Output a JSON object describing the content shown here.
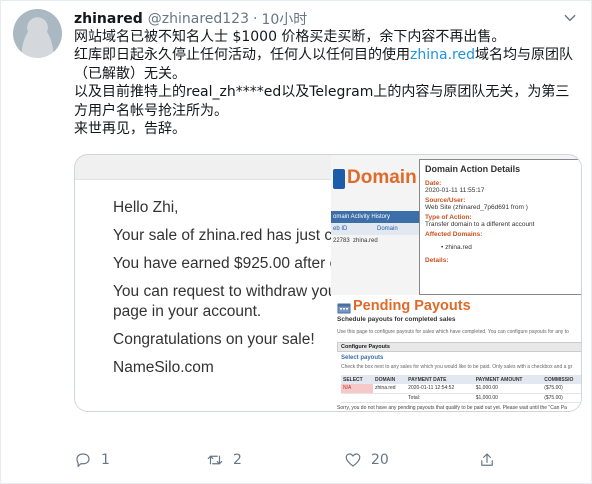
{
  "tweet": {
    "display_name": "zhinared",
    "handle": "@zhinared123",
    "separator": "·",
    "time": "10小时",
    "lines": [
      {
        "before": "网站域名已被不知名人士 $1000 价格买走买断，余下内容不再出售。"
      },
      {
        "before": "红库即日起永久停止任何活动，任何人以任何目的使用",
        "link": "zhina.red",
        "after": "域名均与原团队（已解散）无关。"
      },
      {
        "before": "以及目前推特上的real_zh****ed以及Telegram上的内容与原团队无关，为第三方用户名帐号抢注所为。"
      },
      {
        "before": "来世再见，告辞。"
      }
    ]
  },
  "email": {
    "greeting": "Hello Zhi,",
    "sale": "Your sale of zhina.red has just c",
    "earned": "You have earned $925.00 after c",
    "withdraw_1": "You can request to withdraw you",
    "withdraw_2": "page in your account.",
    "congrats": "Congratulations on your sale!",
    "signature": "NameSilo.com"
  },
  "domain_history": {
    "brand": "Domain H",
    "bar": "omain Activity History",
    "col_id": "eb ID",
    "col_domain": "Domain",
    "row_id": "22783",
    "row_domain": "zhina.red"
  },
  "domain_details": {
    "title": "Domain Action Details",
    "date_label": "Date:",
    "date": "2020-01-11 11:55:17",
    "source_label": "Source/User:",
    "source": "Web Site (zhinared_7p6d691 from )",
    "type_label": "Type of Action:",
    "type": "Transfer domain to a different account",
    "affected_label": "Affected Domains:",
    "affected_domain": "zhina.red",
    "details_label": "Details:"
  },
  "payouts": {
    "title": "Pending Payouts",
    "subtitle": "Schedule payouts for completed sales",
    "use_line": "Use this page to configure payouts for sales which have completed. You can configure payouts for any to",
    "config_bar": "Configure Payouts",
    "select_label": "Select payouts",
    "check_line": "Check the box next to any sales for which you would like to be paid. Only sales with a checkbox and a gr",
    "columns": [
      "SELECT",
      "DOMAIN",
      "PAYMENT DATE",
      "PAYMENT AMOUNT",
      "COMMISSIO"
    ],
    "rows": [
      [
        "N/A",
        "zhina.red",
        "2020-01-11 12:54:52",
        "$1,000.00",
        "($75.00)"
      ],
      [
        "",
        "",
        "Total:",
        "$1,000.00",
        "($75.00)"
      ]
    ],
    "footer": "Sorry, you do not have any pending payouts that qualify to be paid out yet. Please wait until the \"Can Pa"
  },
  "actions": {
    "reply_count": "1",
    "retweet_count": "2",
    "like_count": "20"
  }
}
